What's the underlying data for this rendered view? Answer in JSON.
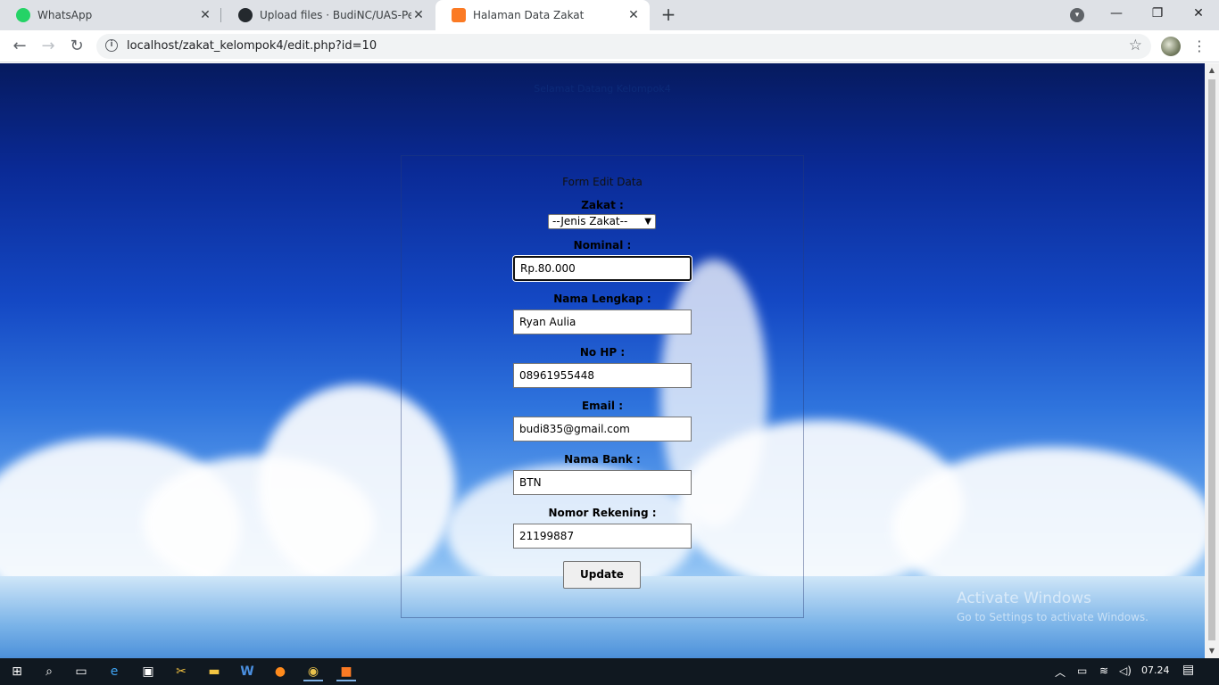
{
  "tabs": [
    {
      "title": "WhatsApp",
      "favicon": "whatsapp-icon"
    },
    {
      "title": "Upload files · BudiNC/UAS-Pemro",
      "favicon": "github-icon"
    },
    {
      "title": "Halaman Data Zakat",
      "favicon": "xampp-icon"
    }
  ],
  "address_bar": {
    "url": "localhost/zakat_kelompok4/edit.php?id=10"
  },
  "page": {
    "welcome": "Selamat Datang Kelompok4",
    "form_title": "Form Edit Data",
    "fields": {
      "zakat_label": "Zakat :",
      "zakat_selected": "--Jenis Zakat--",
      "nominal_label": "Nominal :",
      "nominal_value": "Rp.80.000",
      "nama_label": "Nama Lengkap :",
      "nama_value": "Ryan Aulia",
      "hp_label": "No HP :",
      "hp_value": "08961955448",
      "email_label": "Email :",
      "email_value": "budi835@gmail.com",
      "bank_label": "Nama Bank :",
      "bank_value": "BTN",
      "rekening_label": "Nomor Rekening :",
      "rekening_value": "21199887"
    },
    "update_label": "Update"
  },
  "watermark": {
    "line1": "Activate Windows",
    "line2": "Go to Settings to activate Windows."
  },
  "taskbar": {
    "clock": "07.24"
  },
  "colors": {
    "accent": "#1a73e8",
    "page_bg": "#1448c4",
    "taskbar": "#101820"
  }
}
